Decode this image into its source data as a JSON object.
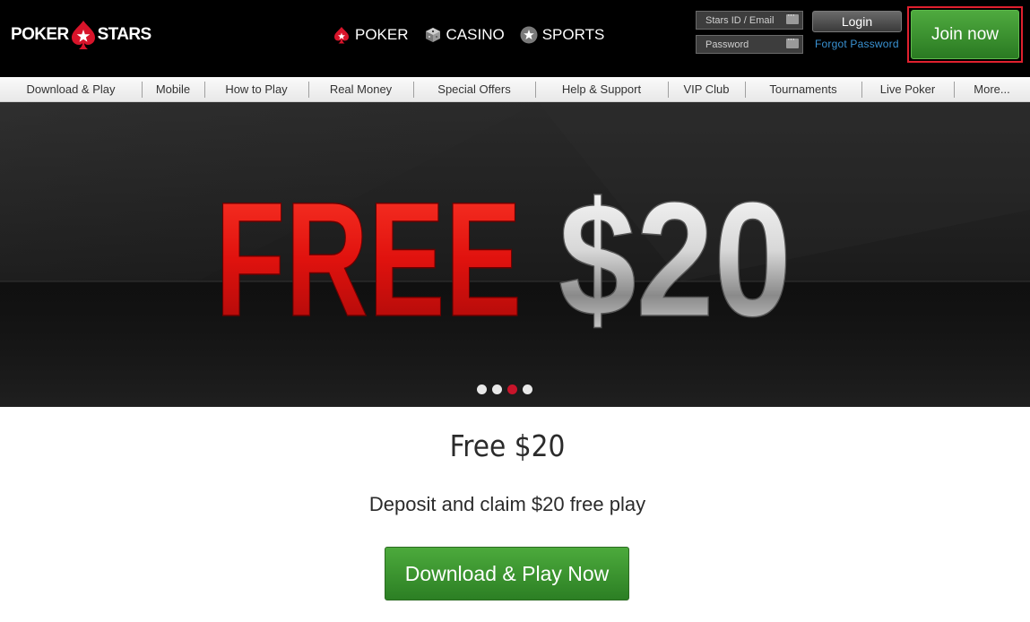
{
  "header": {
    "logo_left": "POKER",
    "logo_right": "STARS",
    "products": [
      {
        "label": "POKER",
        "icon": "spade-icon"
      },
      {
        "label": "CASINO",
        "icon": "dice-icon"
      },
      {
        "label": "SPORTS",
        "icon": "star-icon"
      }
    ],
    "login": {
      "user_placeholder": "Stars ID / Email",
      "password_placeholder": "Password",
      "login_label": "Login",
      "forgot_label": "Forgot Password"
    },
    "join_label": "Join now",
    "colors": {
      "accent_red": "#e0202e",
      "join_green": "#3a9a30",
      "link_blue": "#3a93d4"
    }
  },
  "nav": {
    "items": [
      "Download & Play",
      "Mobile",
      "How to Play",
      "Real Money",
      "Special Offers",
      "Help & Support",
      "VIP Club",
      "Tournaments",
      "Live Poker",
      "More..."
    ]
  },
  "hero": {
    "word": "FREE",
    "amount": "$20",
    "slides": 4,
    "active_slide": 3
  },
  "promo": {
    "title": "Free $20",
    "subtitle": "Deposit and claim $20 free play",
    "cta_label": "Download & Play Now"
  }
}
